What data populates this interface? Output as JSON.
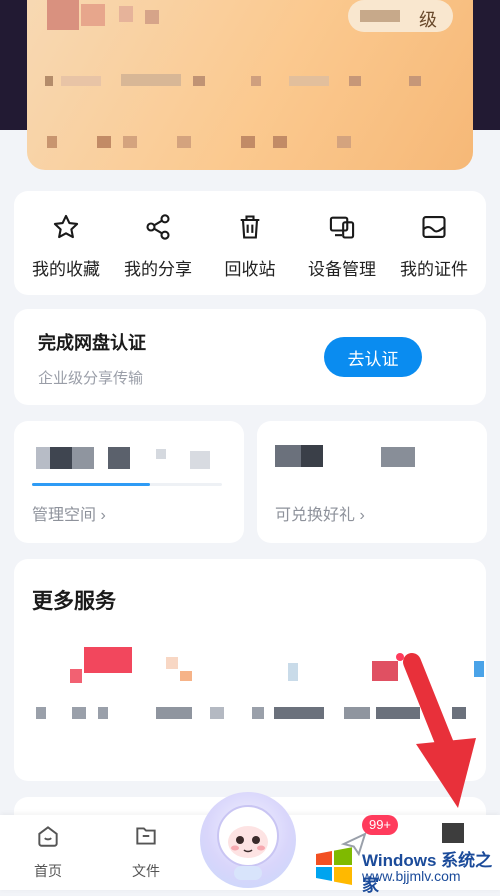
{
  "member_card": {
    "level_text": "级"
  },
  "quick_actions": [
    {
      "label": "我的收藏",
      "icon": "star-icon"
    },
    {
      "label": "我的分享",
      "icon": "share-icon"
    },
    {
      "label": "回收站",
      "icon": "trash-icon"
    },
    {
      "label": "设备管理",
      "icon": "devices-icon"
    },
    {
      "label": "我的证件",
      "icon": "id-card-icon"
    }
  ],
  "verify": {
    "title": "完成网盘认证",
    "subtitle": "企业级分享传输",
    "button": "去认证"
  },
  "storage": {
    "link": "管理空间 ›",
    "used_fraction": 0.62
  },
  "points": {
    "link": "可兑换好礼 ›"
  },
  "more_services": {
    "title": "更多服务"
  },
  "tabbar": {
    "tabs": [
      {
        "label": "首页",
        "icon": "home-face-icon"
      },
      {
        "label": "文件",
        "icon": "folder-icon"
      }
    ],
    "badge": "99+"
  },
  "watermark": {
    "title": "Windows 系统之家",
    "url": "www.bjjmlv.com"
  },
  "colors": {
    "accent": "#0a8cf0",
    "badge": "#ff3b5c",
    "arrow": "#e8303a"
  }
}
